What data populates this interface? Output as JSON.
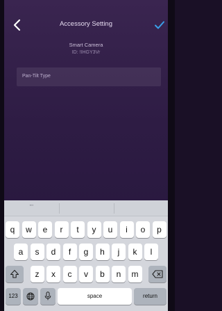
{
  "nav": {
    "title": "Accessory Setting",
    "back_icon": "chevron-left-icon",
    "confirm_icon": "checkmark-icon",
    "accent": "#3aa0e8"
  },
  "device": {
    "name": "Smart Camera",
    "id_text": "ID: !IHGY3Vr"
  },
  "field": {
    "label": "Pan-Tilt Type"
  },
  "keyboard": {
    "predictions": [
      "\"\"",
      "",
      ""
    ],
    "row1": [
      "q",
      "w",
      "e",
      "r",
      "t",
      "y",
      "u",
      "i",
      "o",
      "p"
    ],
    "row2": [
      "a",
      "s",
      "d",
      "f",
      "g",
      "h",
      "j",
      "k",
      "l"
    ],
    "row3": [
      "z",
      "x",
      "c",
      "v",
      "b",
      "n",
      "m"
    ],
    "shift_icon": "shift-icon",
    "delete_icon": "delete-icon",
    "numbers_label": "123",
    "globe_icon": "globe-icon",
    "mic_icon": "microphone-icon",
    "space_label": "space",
    "return_label": "return"
  }
}
